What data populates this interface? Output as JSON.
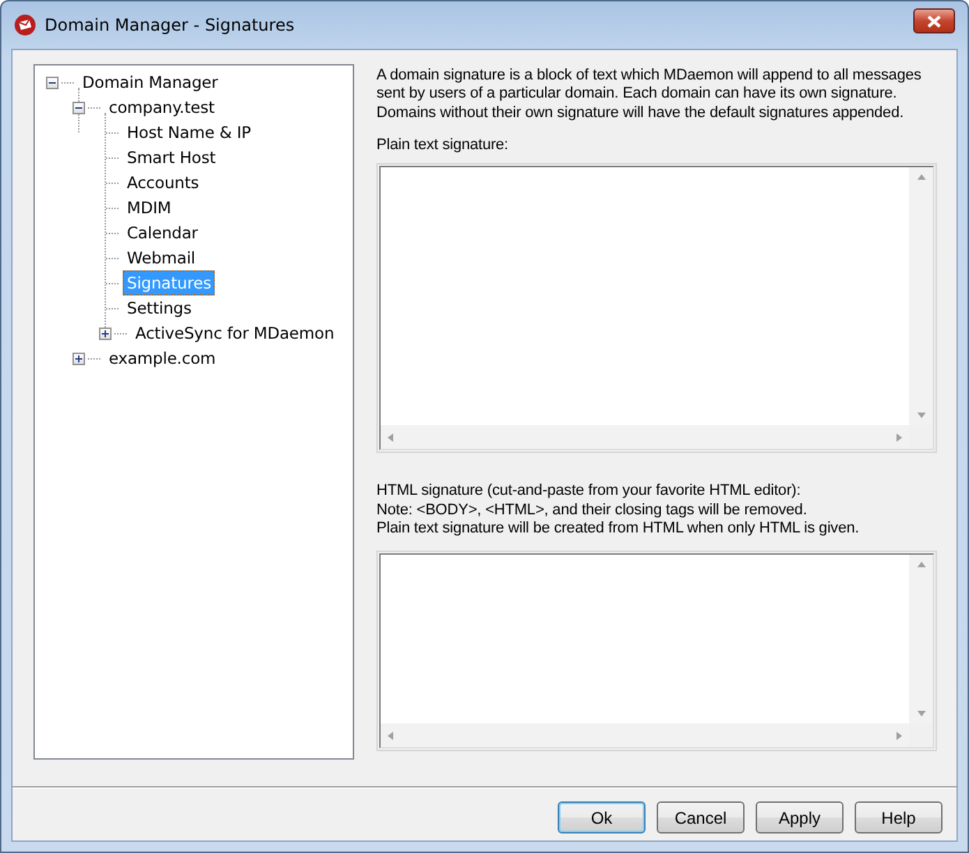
{
  "window": {
    "title": "Domain Manager - Signatures"
  },
  "tree": [
    {
      "label": "Domain Manager",
      "expanded": true,
      "selected": false,
      "children": [
        {
          "label": "company.test",
          "expanded": true,
          "selected": false,
          "children": [
            {
              "label": "Host Name & IP",
              "selected": false
            },
            {
              "label": "Smart Host",
              "selected": false
            },
            {
              "label": "Accounts",
              "selected": false
            },
            {
              "label": "MDIM",
              "selected": false
            },
            {
              "label": "Calendar",
              "selected": false
            },
            {
              "label": "Webmail",
              "selected": false
            },
            {
              "label": "Signatures",
              "selected": true
            },
            {
              "label": "Settings",
              "selected": false
            },
            {
              "label": "ActiveSync for MDaemon",
              "expanded": false,
              "selected": false
            }
          ]
        },
        {
          "label": "example.com",
          "expanded": false,
          "selected": false
        }
      ]
    }
  ],
  "description": "A domain signature is a block of text which MDaemon will append to all messages sent by users of a particular domain.  Each domain can have its own signature. Domains without their own signature will have the default signatures appended.",
  "plain_signature": {
    "label": "Plain text signature:"
  },
  "html_signature": {
    "label_lines": [
      "HTML signature (cut-and-paste from your favorite HTML editor):",
      "Note: <BODY>, <HTML>, and their closing tags will be removed.",
      "Plain text signature will be created from HTML when only HTML is given."
    ]
  },
  "buttons": [
    {
      "label": "Ok",
      "default": true
    },
    {
      "label": "Cancel",
      "default": false
    },
    {
      "label": "Apply",
      "default": false
    },
    {
      "label": "Help",
      "default": false
    }
  ]
}
